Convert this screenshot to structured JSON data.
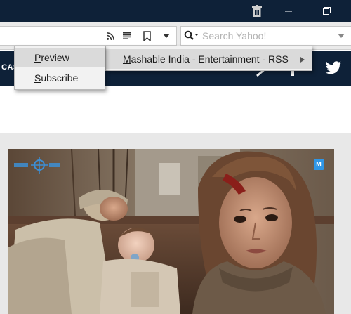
{
  "search": {
    "placeholder": "Search Yahoo!"
  },
  "site": {
    "nav_fragment": "CAS"
  },
  "context_menu": {
    "feed_item": {
      "accel": "M",
      "rest": "ashable India - Entertainment - RSS"
    },
    "submenu": {
      "preview": {
        "accel": "P",
        "rest": "review"
      },
      "subscribe": {
        "accel": "S",
        "rest": "ubscribe"
      }
    }
  },
  "article": {
    "badge": "M"
  },
  "icons": [
    "trash-icon",
    "minimize-icon",
    "restore-icon",
    "rss-icon",
    "reader-view-icon",
    "bookmark-icon",
    "dropdown-icon",
    "search-engine-icon",
    "search-dropdown-icon",
    "site-search-icon",
    "bell-icon",
    "twitter-icon",
    "submenu-arrow-icon"
  ],
  "colors": {
    "header_navy": "#0e2138",
    "twitter_blue": "#1da1f2",
    "badge_blue": "#2f96e6",
    "menu_highlight": "#dadada"
  }
}
